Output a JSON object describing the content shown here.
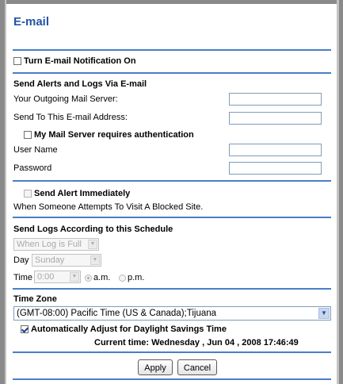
{
  "page": {
    "title": "E-mail"
  },
  "notification": {
    "checkbox_label": "Turn E-mail Notification On",
    "checked": false
  },
  "alerts_section": {
    "heading": "Send Alerts and Logs Via E-mail",
    "outgoing_server_label": "Your Outgoing Mail Server:",
    "outgoing_server_value": "",
    "send_to_label": "Send To This E-mail Address:",
    "send_to_value": "",
    "auth_checkbox_label": "My Mail Server requires authentication",
    "auth_checked": false,
    "username_label": "User Name",
    "username_value": "",
    "password_label": "Password",
    "password_value": ""
  },
  "alert_immediately": {
    "checkbox_label": "Send Alert Immediately",
    "checked": false,
    "description": "When Someone Attempts To Visit A Blocked Site."
  },
  "schedule": {
    "heading": "Send Logs According to this Schedule",
    "frequency_value": "When Log is Full",
    "day_label": "Day",
    "day_value": "Sunday",
    "time_label": "Time",
    "time_value": "0:00",
    "am_label": "a.m.",
    "pm_label": "p.m.",
    "selected_period": "a.m."
  },
  "timezone": {
    "heading": "Time Zone",
    "selected": "(GMT-08:00) Pacific Time (US & Canada);Tijuana",
    "dst_checkbox_label": "Automatically Adjust for Daylight Savings Time",
    "dst_checked": true,
    "current_time": "Current time: Wednesday , Jun 04 , 2008 17:46:49"
  },
  "buttons": {
    "apply_label": "Apply",
    "cancel_label": "Cancel"
  },
  "colors": {
    "title": "#2255a4",
    "divider": "#4a7ec8"
  },
  "icons": {
    "dropdown": "chevron-down-icon"
  }
}
